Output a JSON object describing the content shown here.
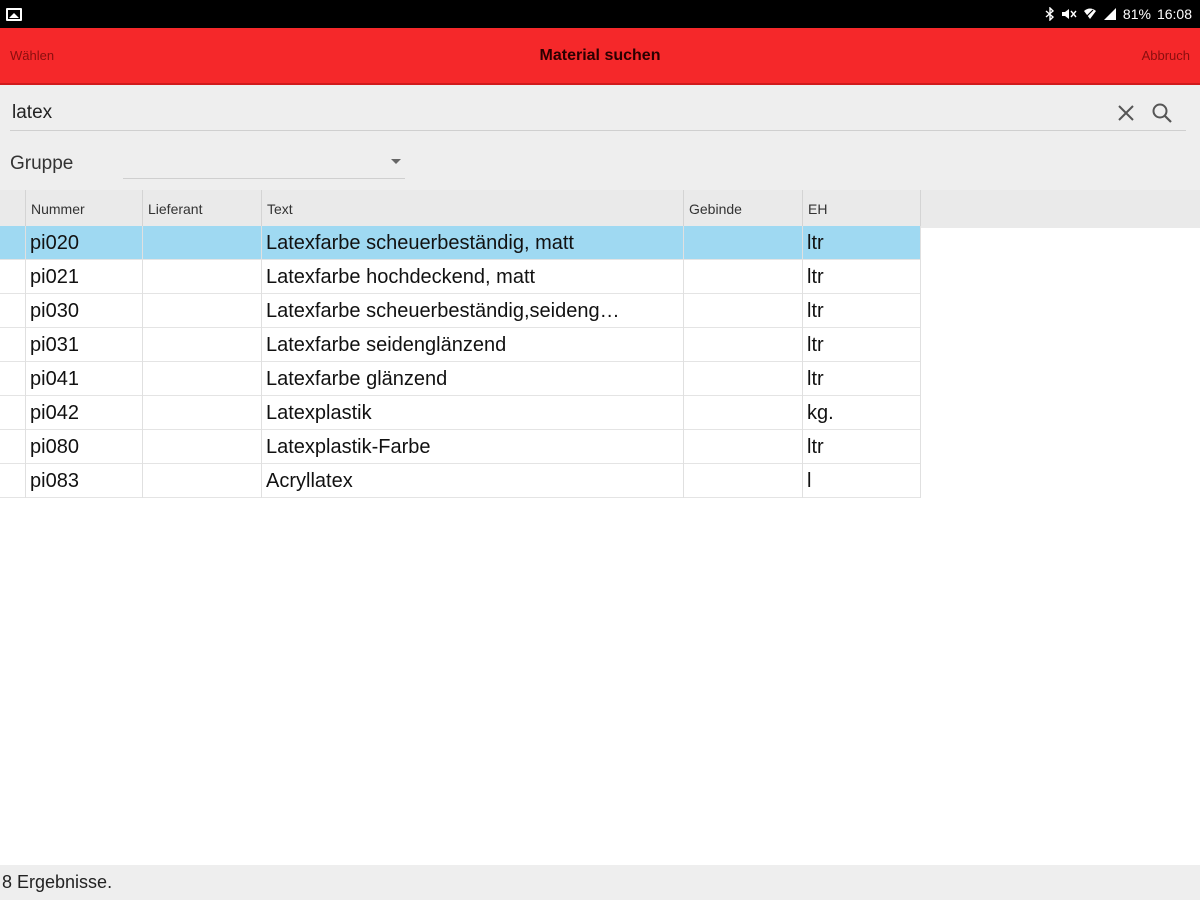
{
  "status_bar": {
    "battery": "81%",
    "time": "16:08",
    "icons": [
      "gallery-icon",
      "bluetooth-icon",
      "mute-icon",
      "wifi-icon",
      "signal-icon"
    ]
  },
  "header": {
    "left_label": "Wählen",
    "title": "Material suchen",
    "right_label": "Abbruch",
    "color": "#f5282a"
  },
  "search": {
    "value": "latex",
    "icons": [
      "close-icon",
      "search-icon"
    ]
  },
  "group": {
    "label": "Gruppe",
    "value": ""
  },
  "table": {
    "columns": [
      "Nummer",
      "Lieferant",
      "Text",
      "Gebinde",
      "EH"
    ],
    "selected_color": "#9fd9f2",
    "rows": [
      {
        "nummer": "pi020",
        "lieferant": "",
        "text": "Latexfarbe scheuerbeständig, matt",
        "gebinde": "",
        "eh": "ltr"
      },
      {
        "nummer": "pi021",
        "lieferant": "",
        "text": "Latexfarbe hochdeckend, matt",
        "gebinde": "",
        "eh": "ltr"
      },
      {
        "nummer": "pi030",
        "lieferant": "",
        "text": "Latexfarbe scheuerbeständig,seideng…",
        "gebinde": "",
        "eh": "ltr"
      },
      {
        "nummer": "pi031",
        "lieferant": "",
        "text": "Latexfarbe seidenglänzend",
        "gebinde": "",
        "eh": "ltr"
      },
      {
        "nummer": "pi041",
        "lieferant": "",
        "text": "Latexfarbe glänzend",
        "gebinde": "",
        "eh": "ltr"
      },
      {
        "nummer": "pi042",
        "lieferant": "",
        "text": "Latexplastik",
        "gebinde": "",
        "eh": "kg."
      },
      {
        "nummer": "pi080",
        "lieferant": "",
        "text": "Latexplastik-Farbe",
        "gebinde": "",
        "eh": "ltr"
      },
      {
        "nummer": "pi083",
        "lieferant": "",
        "text": "Acryllatex",
        "gebinde": "",
        "eh": "l"
      }
    ]
  },
  "footer": {
    "result_text": "8 Ergebnisse."
  }
}
